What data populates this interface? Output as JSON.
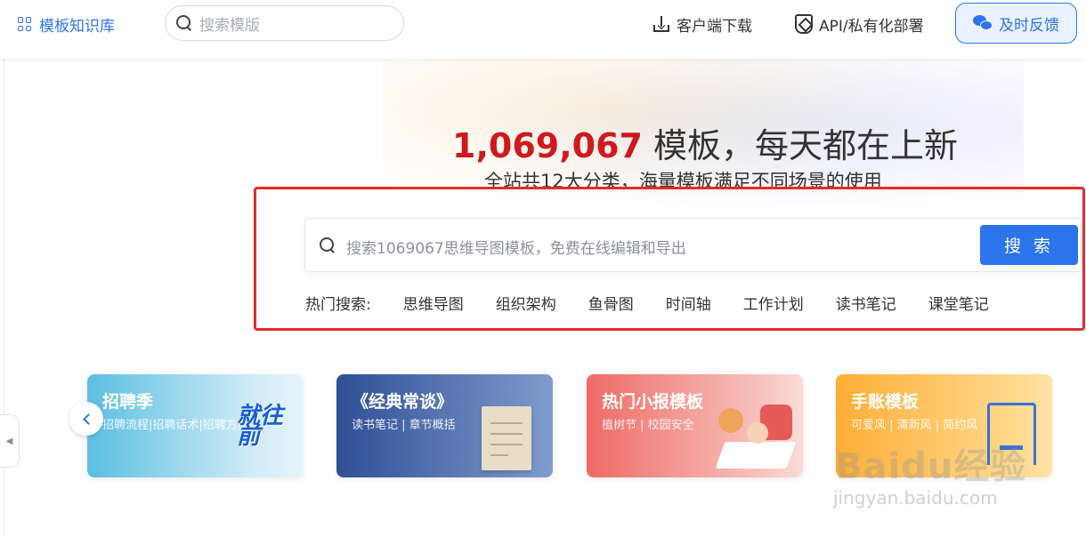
{
  "header": {
    "logo_label": "模板知识库",
    "search_placeholder": "搜索模版",
    "download_label": "客户端下载",
    "api_label": "API/私有化部署",
    "feedback_label": "及时反馈"
  },
  "hero": {
    "count": "1,069,067",
    "title_suffix": " 模板，每天都在上新",
    "subtitle": "全站共12大分类，海量模板满足不同场景的使用",
    "search_placeholder": "搜索1069067思维导图模板，免费在线编辑和导出",
    "search_button": "搜 索"
  },
  "hot_search": {
    "label": "热门搜索:",
    "keywords": [
      "思维导图",
      "组织架构",
      "鱼骨图",
      "时间轴",
      "工作计划",
      "读书笔记",
      "课堂笔记"
    ]
  },
  "cards": [
    {
      "title": "招聘季",
      "subtitle": "招聘流程|招聘话术|招聘方案",
      "art_text": "就往前"
    },
    {
      "title": "《经典常谈》",
      "subtitle": "读书笔记 | 章节概括"
    },
    {
      "title": "热门小报模板",
      "subtitle": "植树节 | 校园安全"
    },
    {
      "title": "手账模板",
      "subtitle": "可爱风 | 清新风 | 简约风"
    }
  ],
  "watermark": {
    "brand": "Baidu经验",
    "url": "jingyan.baidu.com"
  },
  "colors": {
    "accent": "#2b74ec",
    "count_red": "#d0191d",
    "annotation_red": "#e52b2b"
  }
}
